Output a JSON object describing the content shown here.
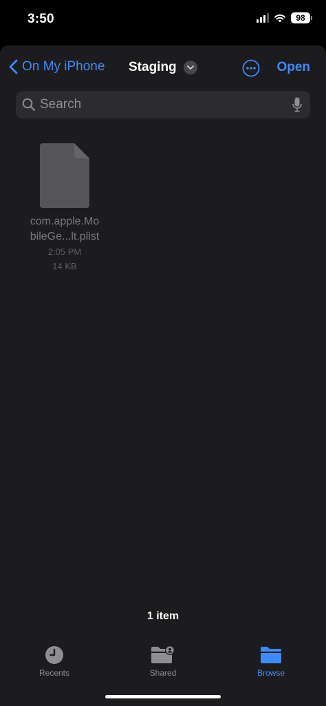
{
  "status_bar": {
    "time": "3:50",
    "battery": "98"
  },
  "nav": {
    "back_label": "On My iPhone",
    "title": "Staging",
    "open_label": "Open"
  },
  "search": {
    "placeholder": "Search"
  },
  "files": [
    {
      "name_line1": "com.apple.Mo",
      "name_line2": "bileGe...lt.plist",
      "time": "2:05 PM",
      "size": "14 KB"
    }
  ],
  "footer": {
    "item_count": "1 item"
  },
  "tabs": [
    {
      "label": "Recents",
      "icon": "clock-icon",
      "active": false
    },
    {
      "label": "Shared",
      "icon": "shared-folder-icon",
      "active": false
    },
    {
      "label": "Browse",
      "icon": "folder-icon",
      "active": true
    }
  ],
  "colors": {
    "accent": "#3d8bfd",
    "background": "#1c1c1e",
    "search_field": "#2c2c2e"
  }
}
